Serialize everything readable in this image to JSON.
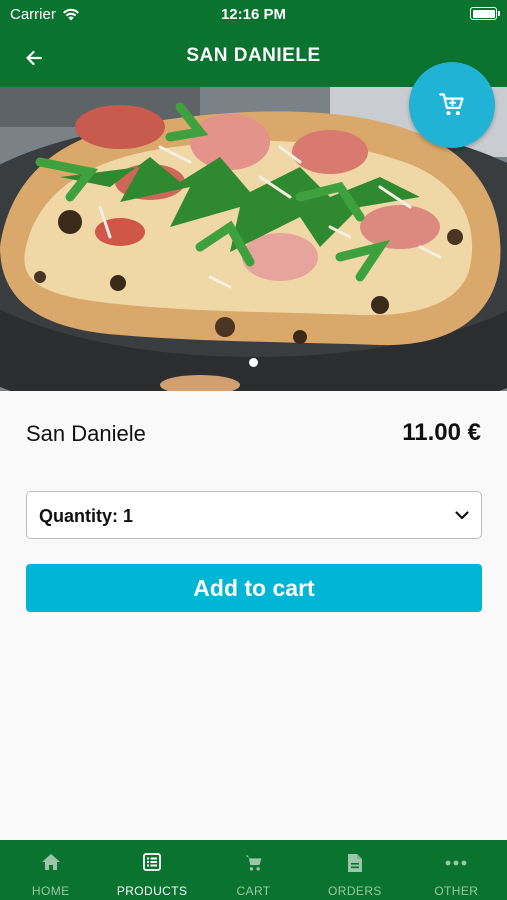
{
  "status_bar": {
    "carrier": "Carrier",
    "time": "12:16 PM"
  },
  "header": {
    "title": "SAN DANIELE",
    "back_icon": "arrow-left-icon"
  },
  "cart_fab": {
    "icon": "shopping-cart-icon",
    "color": "#21b3d6"
  },
  "hero": {
    "image": "pizza-san-daniele-photo",
    "carousel_position": 1,
    "carousel_total": 1
  },
  "product": {
    "name": "San Daniele",
    "price": "11.00 €"
  },
  "quantity": {
    "label": "Quantity: 1",
    "value": 1
  },
  "add_button": {
    "label": "Add to cart",
    "color": "#00b5d5"
  },
  "tabs": [
    {
      "label": "HOME",
      "icon": "home-icon",
      "active": false
    },
    {
      "label": "PRODUCTS",
      "icon": "list-icon",
      "active": true
    },
    {
      "label": "CART",
      "icon": "cart-icon",
      "active": false
    },
    {
      "label": "ORDERS",
      "icon": "document-icon",
      "active": false
    },
    {
      "label": "OTHER",
      "icon": "more-dots-icon",
      "active": false
    }
  ],
  "colors": {
    "brand_green": "#09732f",
    "background": "#f9f9f9",
    "inactive_tab": "#9bc6a9"
  }
}
